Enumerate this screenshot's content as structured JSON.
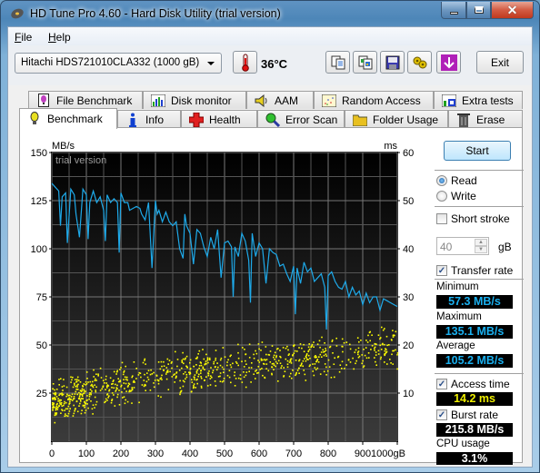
{
  "window": {
    "title": "HD Tune Pro 4.60 - Hard Disk Utility (trial version)",
    "controls": {
      "minimize": "minimize",
      "maximize": "maximize",
      "close": "close"
    }
  },
  "menu": [
    {
      "label": "File",
      "accel": "F",
      "rest": "ile"
    },
    {
      "label": "Help",
      "accel": "H",
      "rest": "elp"
    }
  ],
  "toolbar": {
    "drive": "Hitachi HDS721010CLA332 (1000 gB)",
    "temperature": "36°C",
    "icons": [
      "thermometer-icon",
      "copy-text-icon",
      "copy-screenshot-icon",
      "save-icon",
      "options-icon",
      "download-icon"
    ],
    "exit_label": "Exit"
  },
  "tabs_row1": [
    {
      "label": "File Benchmark",
      "icon": "file-benchmark-icon"
    },
    {
      "label": "Disk monitor",
      "icon": "disk-monitor-icon"
    },
    {
      "label": "AAM",
      "icon": "speaker-icon"
    },
    {
      "label": "Random Access",
      "icon": "random-access-icon"
    },
    {
      "label": "Extra tests",
      "icon": "extra-tests-icon"
    }
  ],
  "tabs_row2": [
    {
      "label": "Benchmark",
      "icon": "lightbulb-icon",
      "active": true
    },
    {
      "label": "Info",
      "icon": "info-icon"
    },
    {
      "label": "Health",
      "icon": "health-cross-icon"
    },
    {
      "label": "Error Scan",
      "icon": "magnifier-icon"
    },
    {
      "label": "Folder Usage",
      "icon": "folder-icon"
    },
    {
      "label": "Erase",
      "icon": "trash-icon"
    }
  ],
  "side": {
    "start_label": "Start",
    "read_label": "Read",
    "write_label": "Write",
    "mode_selected": "Read",
    "short_stroke_label": "Short stroke",
    "short_stroke_checked": false,
    "short_stroke_value": "40",
    "short_stroke_unit": "gB",
    "transfer_rate_label": "Transfer rate",
    "transfer_rate_checked": true,
    "minimum_label": "Minimum",
    "minimum_value": "57.3 MB/s",
    "maximum_label": "Maximum",
    "maximum_value": "135.1 MB/s",
    "average_label": "Average",
    "average_value": "105.2 MB/s",
    "access_time_label": "Access time",
    "access_time_checked": true,
    "access_time_value": "14.2 ms",
    "burst_rate_label": "Burst rate",
    "burst_rate_checked": true,
    "burst_rate_value": "215.8 MB/s",
    "cpu_usage_label": "CPU usage",
    "cpu_usage_value": "3.1%"
  },
  "chart_data": {
    "type": "line",
    "watermark": "trial version",
    "ylabel_left": "MB/s",
    "ylabel_right": "ms",
    "xlabel": "gB",
    "x_ticks": [
      "0",
      "100",
      "200",
      "300",
      "400",
      "500",
      "600",
      "700",
      "800",
      "900",
      "1000gB"
    ],
    "y_left_ticks": [
      "25",
      "50",
      "75",
      "100",
      "125",
      "150"
    ],
    "y_right_ticks": [
      "10",
      "20",
      "30",
      "40",
      "50",
      "60"
    ],
    "xlim": [
      0,
      1000
    ],
    "ylim_left": [
      0,
      150
    ],
    "ylim_right": [
      0,
      60
    ],
    "grid": true,
    "series": [
      {
        "name": "Transfer rate (MB/s)",
        "color": "#1eaaea",
        "x": [
          0,
          10,
          20,
          25,
          30,
          40,
          45,
          55,
          65,
          70,
          80,
          90,
          100,
          105,
          110,
          120,
          130,
          140,
          150,
          155,
          160,
          170,
          180,
          190,
          195,
          200,
          210,
          220,
          225,
          235,
          245,
          255,
          260,
          270,
          280,
          290,
          300,
          305,
          310,
          320,
          330,
          340,
          350,
          360,
          370,
          380,
          385,
          390,
          400,
          410,
          420,
          430,
          440,
          450,
          460,
          470,
          480,
          490,
          500,
          510,
          520,
          525,
          530,
          540,
          550,
          560,
          570,
          575,
          580,
          590,
          600,
          610,
          620,
          630,
          640,
          650,
          660,
          670,
          680,
          690,
          700,
          705,
          710,
          720,
          730,
          740,
          750,
          760,
          770,
          780,
          790,
          795,
          800,
          810,
          820,
          830,
          840,
          850,
          860,
          870,
          880,
          890,
          900,
          910,
          920,
          930,
          940,
          950,
          960,
          970,
          980,
          990,
          1000
        ],
        "values": [
          134,
          132,
          130,
          112,
          127,
          129,
          103,
          131,
          128,
          118,
          106,
          131,
          128,
          105,
          124,
          130,
          124,
          127,
          120,
          104,
          128,
          124,
          126,
          124,
          98,
          129,
          124,
          124,
          120,
          121,
          122,
          121,
          118,
          115,
          124,
          90,
          125,
          118,
          120,
          114,
          119,
          114,
          112,
          114,
          100,
          95,
          118,
          112,
          108,
          92,
          110,
          108,
          101,
          96,
          106,
          100,
          110,
          85,
          103,
          104,
          101,
          75,
          101,
          96,
          108,
          104,
          94,
          72,
          108,
          96,
          103,
          100,
          82,
          100,
          98,
          97,
          91,
          92,
          87,
          83,
          91,
          66,
          90,
          82,
          93,
          88,
          90,
          83,
          85,
          87,
          80,
          58,
          86,
          88,
          83,
          80,
          79,
          83,
          75,
          80,
          76,
          78,
          71,
          77,
          72,
          75,
          75,
          68,
          74,
          73,
          72,
          71,
          70
        ]
      },
      {
        "name": "Access time (ms)",
        "color": "#ffff00",
        "type": "scatter",
        "description": "random access time samples spread between ~3 and ~25 ms, rising from ~7 ms near 0 gB to ~20 ms near 1000 gB",
        "trend_x": [
          0,
          100,
          200,
          300,
          400,
          500,
          600,
          700,
          800,
          900,
          1000
        ],
        "trend_values": [
          8,
          10.5,
          12,
          13.5,
          14.5,
          15.5,
          16.5,
          17,
          18,
          19,
          20
        ],
        "spread_ms": 5
      }
    ]
  }
}
